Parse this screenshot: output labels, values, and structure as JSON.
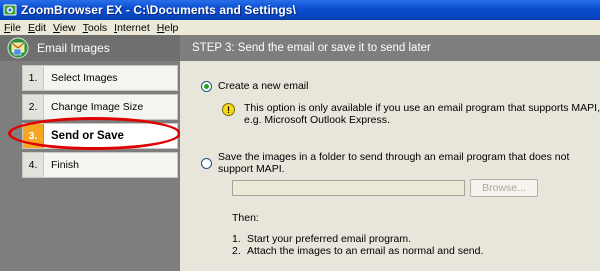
{
  "window": {
    "title": "ZoomBrowser EX  - C:\\Documents and Settings\\"
  },
  "menu": [
    {
      "underline": "F",
      "rest": "ile"
    },
    {
      "underline": "E",
      "rest": "dit"
    },
    {
      "underline": "V",
      "rest": "iew"
    },
    {
      "underline": "T",
      "rest": "ools"
    },
    {
      "underline": "I",
      "rest": "nternet"
    },
    {
      "underline": "H",
      "rest": "elp"
    }
  ],
  "left_panel": {
    "header": "Email Images",
    "steps": [
      {
        "num": "1.",
        "label": "Select Images"
      },
      {
        "num": "2.",
        "label": "Change Image Size"
      },
      {
        "num": "3.",
        "label": "Send or Save"
      },
      {
        "num": "4.",
        "label": "Finish"
      }
    ]
  },
  "right_panel": {
    "header": "STEP 3: Send the email or save it to send later",
    "option_new_email": "Create a new email",
    "info_line1": "This option is only available if you use an email program that supports MAPI,",
    "info_line2": "e.g. Microsoft Outlook Express.",
    "option_save": "Save the images in a folder to send through an email program that does not support MAPI.",
    "path_value": "",
    "browse_label": "Browse...",
    "then_label": "Then:",
    "instructions": [
      {
        "num": "1.",
        "text": "Start your preferred email program."
      },
      {
        "num": "2.",
        "text": "Attach the images to an email as normal and send."
      }
    ]
  },
  "colors": {
    "title_bar": "#0a4fd0",
    "active_step": "#f5a623",
    "highlight": "#e00000"
  },
  "icons": {
    "app": "zoombrowser-icon",
    "header": "email-images-icon",
    "info": "warning-icon"
  }
}
